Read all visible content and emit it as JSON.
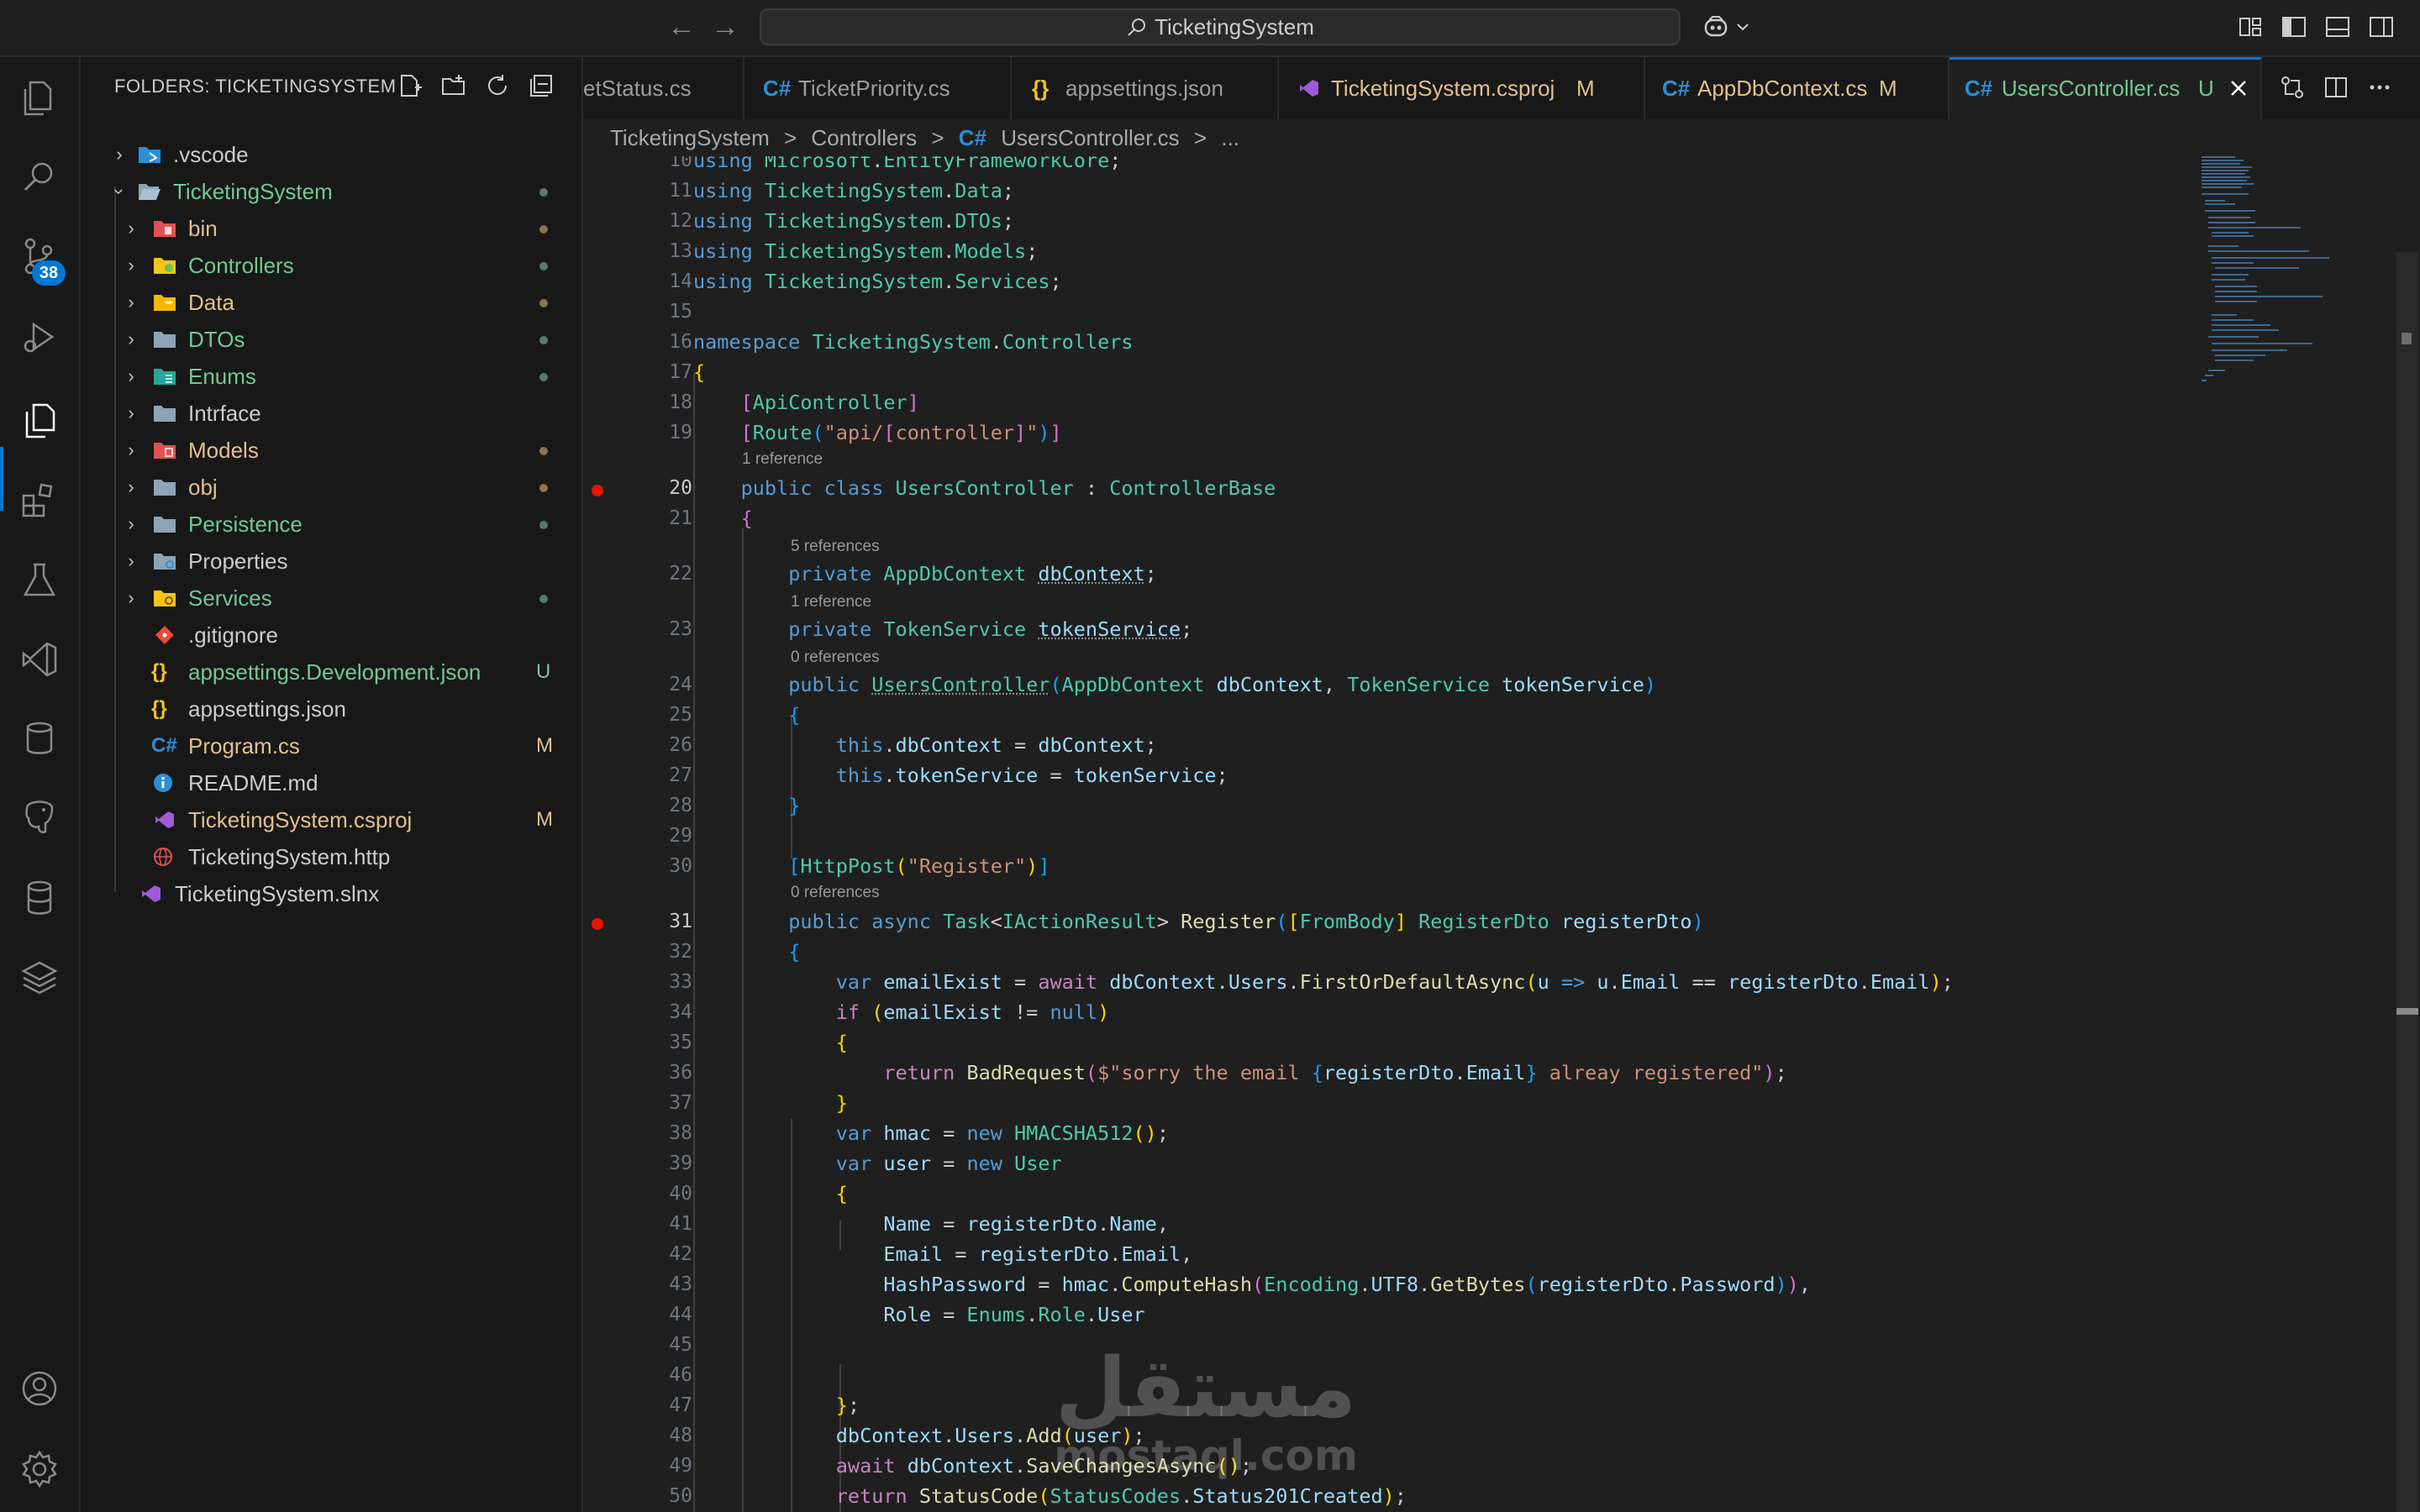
{
  "titlebar": {
    "search_text": "TicketingSystem",
    "back_label": "←",
    "forward_label": "→"
  },
  "activity_bar": {
    "icons": [
      "explorer-icon",
      "search-icon",
      "source-control-icon",
      "run-debug-icon",
      "explorer-files-icon",
      "extensions-icon",
      "testing-icon",
      "visual-studio-icon",
      "database-icon",
      "postgres-icon",
      "database2-icon",
      "layers-icon",
      "account-icon",
      "settings-gear-icon"
    ],
    "scm_badge": "38",
    "accent": "#0078d4"
  },
  "sidebar": {
    "header": "FOLDERS: TICKETINGSYSTEM",
    "items": [
      {
        "label": ".vscode",
        "color": "#cccccc"
      },
      {
        "label": "TicketingSystem",
        "color": "#73c991"
      },
      {
        "label": "bin",
        "color": "#e2c08d"
      },
      {
        "label": "Controllers",
        "color": "#73c991"
      },
      {
        "label": "Data",
        "color": "#e2c08d"
      },
      {
        "label": "DTOs",
        "color": "#73c991"
      },
      {
        "label": "Enums",
        "color": "#73c991"
      },
      {
        "label": "Intrface",
        "color": "#cccccc"
      },
      {
        "label": "Models",
        "color": "#e2c08d"
      },
      {
        "label": "obj",
        "color": "#e2c08d"
      },
      {
        "label": "Persistence",
        "color": "#73c991"
      },
      {
        "label": "Properties",
        "color": "#cccccc"
      },
      {
        "label": "Services",
        "color": "#73c991"
      },
      {
        "label": ".gitignore",
        "color": "#cccccc"
      },
      {
        "label": "appsettings.Development.json",
        "color": "#73c991",
        "flag": "U"
      },
      {
        "label": "appsettings.json",
        "color": "#cccccc"
      },
      {
        "label": "Program.cs",
        "color": "#e2c08d",
        "flag": "M"
      },
      {
        "label": "README.md",
        "color": "#cccccc"
      },
      {
        "label": "TicketingSystem.csproj",
        "color": "#e2c08d",
        "flag": "M"
      },
      {
        "label": "TicketingSystem.http",
        "color": "#cccccc"
      },
      {
        "label": "TicketingSystem.slnx",
        "color": "#cccccc"
      }
    ]
  },
  "tabs": [
    {
      "label": "etStatus.cs",
      "icon": "",
      "mod": ""
    },
    {
      "label": "TicketPriority.cs",
      "icon": "C#",
      "mod": ""
    },
    {
      "label": "appsettings.json",
      "icon": "{}",
      "mod": ""
    },
    {
      "label": "TicketingSystem.csproj",
      "icon": "",
      "mod": "M"
    },
    {
      "label": "AppDbContext.cs",
      "icon": "C#",
      "mod": "M"
    },
    {
      "label": "UsersController.cs",
      "icon": "C#",
      "mod": "U"
    }
  ],
  "breadcrumbs": [
    "TicketingSystem",
    ">",
    "Controllers",
    ">",
    "C#",
    "UsersController.cs",
    ">",
    "..."
  ],
  "editor": {
    "line_numbers": [
      "10",
      "11",
      "12",
      "13",
      "14",
      "15",
      "16",
      "17",
      "18",
      "19",
      "20",
      "21",
      "22",
      "23",
      "24",
      "25",
      "26",
      "27",
      "28",
      "29",
      "30",
      "31",
      "32",
      "33",
      "34",
      "35",
      "36",
      "37",
      "38",
      "39",
      "40",
      "41",
      "42",
      "43",
      "44",
      "45",
      "46",
      "47",
      "48",
      "49",
      "50"
    ],
    "codelens": [
      "1 reference",
      "5 references",
      "1 reference",
      "0 references",
      "0 references"
    ]
  },
  "watermark": {
    "line1": "مستقل",
    "line2": "mostaql.com"
  }
}
